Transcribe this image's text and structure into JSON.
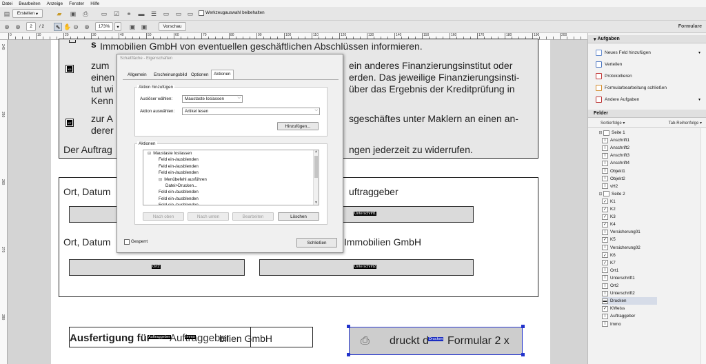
{
  "menubar": [
    "Datei",
    "Bearbeiten",
    "Anzeige",
    "Fenster",
    "Hilfe"
  ],
  "toolbar": {
    "create_label": "Erstellen",
    "page_current": "2",
    "page_total": "/ 2",
    "zoom": "173%",
    "preview_label": "Vorschau",
    "keep_tool_label": "Werkzeugauswahl beibehalten",
    "formulare_label": "Formulare"
  },
  "ruler": {
    "top": [
      "0",
      "10",
      "20",
      "30",
      "40",
      "50",
      "60",
      "70",
      "80",
      "90",
      "100",
      "110",
      "120",
      "130",
      "140",
      "150",
      "160",
      "170",
      "180",
      "190",
      "200"
    ],
    "left": [
      "240",
      "250",
      "260",
      "270",
      "280"
    ]
  },
  "document": {
    "line1": "Immobilien GmbH von eventuellen geschäftlichen Abschlüssen informieren.",
    "p_zum_1": "zum",
    "p_zum_1b": "einen",
    "p_zum_1c": "tut wi",
    "p_zum_1d": "Kenn",
    "r_1a": "ein anderes Finanzierungsinstitut oder",
    "r_1b": "erden. Das jeweilige Finanzierungsinsti-",
    "r_1c": "über das Ergebnis der Kreditprüfung in",
    "p_zum_2": "zur A",
    "p_zum_2b": "derer",
    "r_2a": "sgeschäftes unter Maklern an einen an-",
    "auftrag_l": "Der Auftrag",
    "auftrag_r": "ngen jederzeit zu widerrufen.",
    "ort1_l": "Ort, Datum",
    "ort1_r": "uftraggeber",
    "ort2_l": "Ort, Datum",
    "ort2_r": "Immobilien GmbH",
    "field_unterschrift1": "Unterschrift1",
    "field_ort2": "Ort2",
    "field_unterschrift2": "Unterschrift2",
    "ausfertigung_a": "Ausfertigung für",
    "ausfertigung_b": "bilien GmbH",
    "ausfertigung_overlap": "Auftraggeber",
    "field_auftraggeber": "Auftraggeber",
    "field_immo": "Immo",
    "print_text": "druckt d",
    "print_text_b": "Formular 2 x",
    "field_drucken": "Drucken",
    "checkbox_k6": "K6",
    "checkbox_k7": "K7"
  },
  "dialog": {
    "title": "Schaltfläche - Eigenschaften",
    "tabs": [
      "Allgemein",
      "Erscheinungsbild",
      "Optionen",
      "Aktionen"
    ],
    "group_add": "Aktion hinzufügen",
    "trigger_label": "Auslöser wählen:",
    "trigger_value": "Maustaste loslassen",
    "action_label": "Aktion auswählen:",
    "action_value": "Artikel lesen",
    "add_button": "Hinzufügen...",
    "group_actions": "Aktionen",
    "actions_list": [
      {
        "text": "Maustaste loslassen",
        "level": 0,
        "toggle": "⊟"
      },
      {
        "text": "Feld ein-/ausblenden",
        "level": 1
      },
      {
        "text": "Feld ein-/ausblenden",
        "level": 1
      },
      {
        "text": "Feld ein-/ausblenden",
        "level": 1
      },
      {
        "text": "Menübefehl ausführen",
        "level": 1,
        "toggle": "⊟"
      },
      {
        "text": "Datei>Drucken...",
        "level": 2
      },
      {
        "text": "Feld ein-/ausblenden",
        "level": 1
      },
      {
        "text": "Feld ein-/ausblenden",
        "level": 1
      },
      {
        "text": "Feld ein-/ausblenden",
        "level": 1
      }
    ],
    "btn_up": "Nach oben",
    "btn_down": "Nach unten",
    "btn_edit": "Bearbeiten",
    "btn_delete": "Löschen",
    "locked_label": "Gesperrt",
    "close_button": "Schließen"
  },
  "panel": {
    "tasks_header": "Aufgaben",
    "tasks": [
      {
        "label": "Neues Feld hinzufügen",
        "arrow": "▾"
      },
      {
        "label": "Verteilen",
        "arrow": ""
      },
      {
        "label": "Protokollieren",
        "arrow": ""
      },
      {
        "label": "Formularbearbeitung schließen",
        "arrow": ""
      },
      {
        "label": "Andere Aufgaben",
        "arrow": "▾"
      }
    ],
    "fields_header": "Felder",
    "sort_label": "Sortierfolge ▾",
    "taborder_label": "Tab-Reihenfolge ▾",
    "tree": [
      {
        "label": "Seite 1",
        "level": 0,
        "toggle": "⊟",
        "icon": "page"
      },
      {
        "label": "Anschrift1",
        "level": 1,
        "icon": "text"
      },
      {
        "label": "Anschrift2",
        "level": 1,
        "icon": "text"
      },
      {
        "label": "Anschrift3",
        "level": 1,
        "icon": "text"
      },
      {
        "label": "Anschrift4",
        "level": 1,
        "icon": "text"
      },
      {
        "label": "Objekt1",
        "level": 1,
        "icon": "text"
      },
      {
        "label": "Objekt2",
        "level": 1,
        "icon": "text"
      },
      {
        "label": "vH2",
        "level": 1,
        "icon": "text"
      },
      {
        "label": "Seite 2",
        "level": 0,
        "toggle": "⊟",
        "icon": "page"
      },
      {
        "label": "K1",
        "level": 1,
        "icon": "check"
      },
      {
        "label": "K2",
        "level": 1,
        "icon": "check"
      },
      {
        "label": "K3",
        "level": 1,
        "icon": "check"
      },
      {
        "label": "K4",
        "level": 1,
        "icon": "check"
      },
      {
        "label": "Versicherung01",
        "level": 1,
        "icon": "text"
      },
      {
        "label": "K5",
        "level": 1,
        "icon": "check"
      },
      {
        "label": "Versicherung02",
        "level": 1,
        "icon": "text"
      },
      {
        "label": "K6",
        "level": 1,
        "icon": "check"
      },
      {
        "label": "K7",
        "level": 1,
        "icon": "check"
      },
      {
        "label": "Ort1",
        "level": 1,
        "icon": "text"
      },
      {
        "label": "Unterschrift1",
        "level": 1,
        "icon": "text"
      },
      {
        "label": "Ort2",
        "level": 1,
        "icon": "text"
      },
      {
        "label": "Unterschrift2",
        "level": 1,
        "icon": "text"
      },
      {
        "label": "Drucken",
        "level": 1,
        "icon": "button",
        "selected": true
      },
      {
        "label": "KWeiss",
        "level": 1,
        "icon": "check"
      },
      {
        "label": "Auftraggeber",
        "level": 1,
        "icon": "text"
      },
      {
        "label": "Immo",
        "level": 1,
        "icon": "text"
      }
    ]
  }
}
